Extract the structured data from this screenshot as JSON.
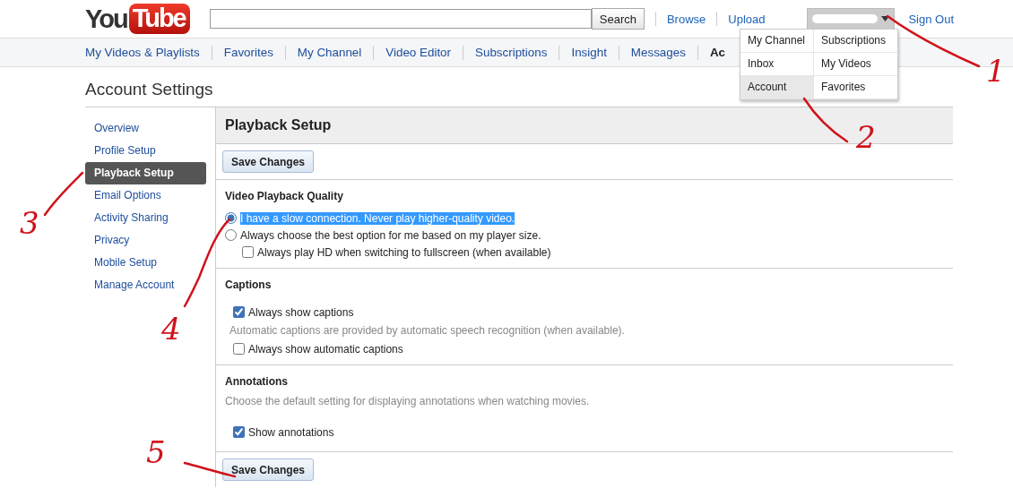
{
  "header": {
    "logo": {
      "part_1": "You",
      "part_2": "Tube"
    },
    "search_button": "Search",
    "links": [
      "Browse",
      "Upload"
    ],
    "account_menu": {
      "expanded": true
    },
    "sign_out": "Sign Out"
  },
  "nav_tabs": [
    {
      "label": "My Videos & Playlists",
      "selected": false
    },
    {
      "label": "Favorites",
      "selected": false
    },
    {
      "label": "My Channel",
      "selected": false
    },
    {
      "label": "Video Editor",
      "selected": false
    },
    {
      "label": "Subscriptions",
      "selected": false
    },
    {
      "label": "Insight",
      "selected": false
    },
    {
      "label": "Messages",
      "selected": false
    },
    {
      "label": "Ac",
      "selected": true
    }
  ],
  "account_menu_items": [
    {
      "label": "My Channel",
      "selected": false
    },
    {
      "label": "Subscriptions",
      "selected": false
    },
    {
      "label": "Inbox",
      "selected": false
    },
    {
      "label": "My Videos",
      "selected": false
    },
    {
      "label": "Account",
      "selected": true
    },
    {
      "label": "Favorites",
      "selected": false
    }
  ],
  "page_title": "Account Settings",
  "sidebar": {
    "items": [
      {
        "label": "Overview",
        "selected": false
      },
      {
        "label": "Profile Setup",
        "selected": false
      },
      {
        "label": "Playback Setup",
        "selected": true
      },
      {
        "label": "Email Options",
        "selected": false
      },
      {
        "label": "Activity Sharing",
        "selected": false
      },
      {
        "label": "Privacy",
        "selected": false
      },
      {
        "label": "Mobile Setup",
        "selected": false
      },
      {
        "label": "Manage Account",
        "selected": false
      }
    ]
  },
  "panel": {
    "title": "Playback Setup",
    "top_button": "Save Changes",
    "bottom_button": "Save Changes",
    "sections": [
      {
        "heading": "Video Playback Quality",
        "options": [
          {
            "kind": "radio",
            "label": "I have a slow connection. Never play higher-quality video.",
            "selected": true,
            "highlighted": true
          },
          {
            "kind": "radio",
            "label": "Always choose the best option for me based on my player size.",
            "selected": false,
            "highlighted": false,
            "children": [
              {
                "kind": "checkbox",
                "label": "Always play HD when switching to fullscreen (when available)",
                "checked": false
              }
            ]
          }
        ]
      },
      {
        "heading": "Captions",
        "options": [
          {
            "kind": "checkbox",
            "label": "Always show captions",
            "checked": true
          },
          {
            "kind": "note",
            "label": "Automatic captions are provided by automatic speech recognition (when available)."
          },
          {
            "kind": "checkbox",
            "label": "Always show automatic captions",
            "checked": false
          }
        ]
      },
      {
        "heading": "Annotations",
        "description": "Choose the default setting for displaying annotations when watching movies.",
        "options": [
          {
            "kind": "checkbox",
            "label": "Show annotations",
            "checked": true
          }
        ]
      }
    ]
  },
  "annotation_marks": [
    {
      "label": "1"
    },
    {
      "label": "2"
    },
    {
      "label": "3"
    },
    {
      "label": "4"
    },
    {
      "label": "5"
    }
  ]
}
